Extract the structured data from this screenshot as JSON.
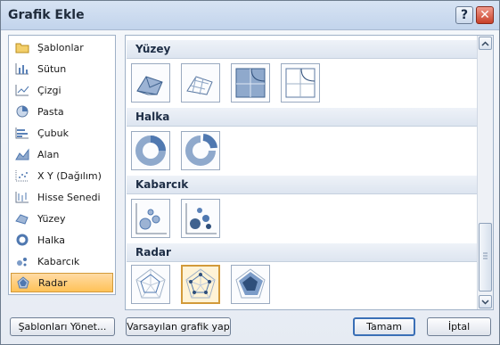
{
  "window": {
    "title": "Grafik Ekle",
    "help_label": "?",
    "close_label": "✕"
  },
  "left_list": [
    {
      "label": "Şablonlar",
      "icon": "folder-icon"
    },
    {
      "label": "Sütun",
      "icon": "column-chart-icon"
    },
    {
      "label": "Çizgi",
      "icon": "line-chart-icon"
    },
    {
      "label": "Pasta",
      "icon": "pie-chart-icon"
    },
    {
      "label": "Çubuk",
      "icon": "bar-chart-icon"
    },
    {
      "label": "Alan",
      "icon": "area-chart-icon"
    },
    {
      "label": "X Y (Dağılım)",
      "icon": "scatter-chart-icon"
    },
    {
      "label": "Hisse Senedi",
      "icon": "stock-chart-icon"
    },
    {
      "label": "Yüzey",
      "icon": "surface-chart-icon"
    },
    {
      "label": "Halka",
      "icon": "doughnut-chart-icon"
    },
    {
      "label": "Kabarcık",
      "icon": "bubble-chart-icon"
    },
    {
      "label": "Radar",
      "icon": "radar-chart-icon",
      "selected": true
    }
  ],
  "sections": [
    {
      "title": "Yüzey",
      "thumbs": [
        "surface-3d-icon",
        "wireframe-surface-3d-icon",
        "contour-icon",
        "wireframe-contour-icon"
      ]
    },
    {
      "title": "Halka",
      "thumbs": [
        "doughnut-icon",
        "exploded-doughnut-icon"
      ]
    },
    {
      "title": "Kabarcık",
      "thumbs": [
        "bubble-icon",
        "bubble-3d-icon"
      ]
    },
    {
      "title": "Radar",
      "thumbs": [
        "radar-icon",
        "radar-markers-icon",
        "filled-radar-icon"
      ],
      "selected_index": 1
    }
  ],
  "buttons": {
    "manage_templates": "Şablonları Yönet...",
    "set_default": "Varsayılan grafik yap",
    "ok": "Tamam",
    "cancel": "İptal"
  }
}
